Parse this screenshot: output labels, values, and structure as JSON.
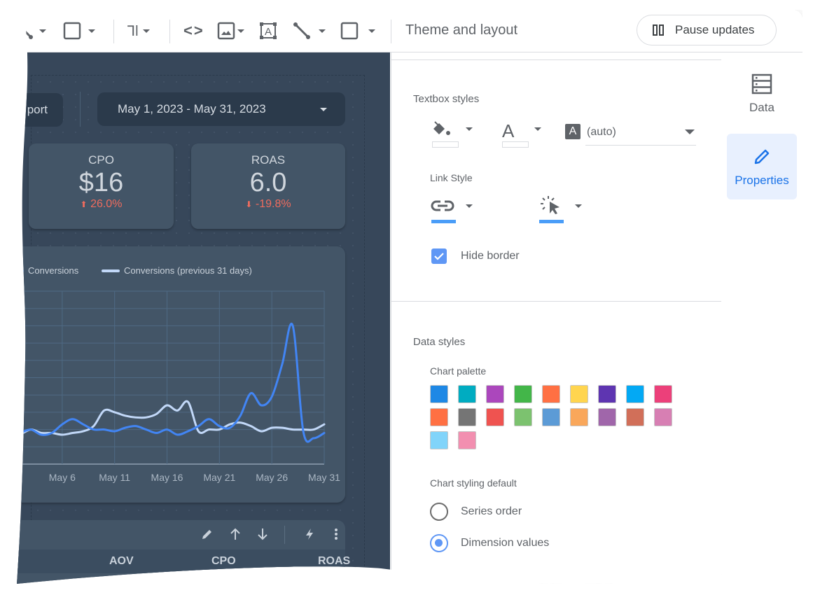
{
  "toolbar": {
    "tools": [
      {
        "name": "line-tool",
        "has_dropdown": true
      },
      {
        "name": "rectangle-tool",
        "has_dropdown": true
      },
      {
        "name": "text-format-tool",
        "glyph": "Ꞁl",
        "has_dropdown": true
      },
      {
        "name": "embed-code-tool",
        "glyph": "<>"
      },
      {
        "name": "image-tool",
        "has_dropdown": true
      },
      {
        "name": "text-box-tool"
      },
      {
        "name": "line-tool-2",
        "has_dropdown": true
      },
      {
        "name": "shape-tool",
        "has_dropdown": true
      }
    ],
    "theme_label": "Theme and layout",
    "pause_label": "Pause updates"
  },
  "canvas": {
    "report_button_label": "port",
    "date_range": "May 1, 2023 - May 31, 2023",
    "kpis": [
      {
        "label": "CPO",
        "value": "$16",
        "change": "26.0%",
        "direction": "up"
      },
      {
        "label": "ROAS",
        "value": "6.0",
        "change": "-19.8%",
        "direction": "down"
      }
    ],
    "table": {
      "columns": [
        "AOV",
        "CPO",
        "ROAS"
      ]
    }
  },
  "chart_data": {
    "type": "line",
    "title": "",
    "xlabel": "",
    "ylabel": "",
    "x_tick_labels": [
      "May 6",
      "May 11",
      "May 16",
      "May 21",
      "May 26",
      "May 31"
    ],
    "x": [
      2,
      3,
      4,
      5,
      6,
      7,
      8,
      9,
      10,
      11,
      12,
      13,
      14,
      15,
      16,
      17,
      18,
      19,
      20,
      21,
      22,
      23,
      24,
      25,
      26,
      27,
      28,
      29,
      30,
      31
    ],
    "grid": true,
    "legend_position": "top-left",
    "y_gridlines": 10,
    "ylim": [
      0,
      10
    ],
    "series": [
      {
        "name": "Conversions",
        "color": "#4285f4",
        "values": [
          1.8,
          2.0,
          1.7,
          1.8,
          2.3,
          2.6,
          2.3,
          2.0,
          2.0,
          1.9,
          2.1,
          2.2,
          2.0,
          1.8,
          2.0,
          1.7,
          1.9,
          2.2,
          2.6,
          2.2,
          2.1,
          2.8,
          4.1,
          3.4,
          3.9,
          5.8,
          8.0,
          1.9,
          1.5,
          1.8
        ]
      },
      {
        "name": "Conversions (previous 31 days)",
        "color": "#c2d8f8",
        "values": [
          1.7,
          2.0,
          1.8,
          1.8,
          1.7,
          1.8,
          1.9,
          2.2,
          3.1,
          3.0,
          2.8,
          2.7,
          2.7,
          2.9,
          3.4,
          3.1,
          3.6,
          1.9,
          2.0,
          2.0,
          2.3,
          2.4,
          2.2,
          1.9,
          2.1,
          2.1,
          2.0,
          2.0,
          2.0,
          2.3
        ]
      }
    ]
  },
  "panel": {
    "textbox_styles_title": "Textbox styles",
    "font_family_value": "(auto)",
    "link_style_title": "Link Style",
    "hide_border_label": "Hide border",
    "hide_border_checked": true,
    "data_styles_title": "Data styles",
    "chart_palette_title": "Chart palette",
    "palette": [
      "#1e88e5",
      "#00acc1",
      "#ab47bc",
      "#43b649",
      "#ff7043",
      "#ffd54f",
      "#5e35b1",
      "#03a9f4",
      "#ec407a",
      "#ff7043",
      "#757575",
      "#ef5350",
      "#7cc26f",
      "#5c9bd6",
      "#f9a75b",
      "#a066aa",
      "#d16f59",
      "#d77fb3",
      "#81d4fa",
      "#f28fb0"
    ],
    "chart_styling_title": "Chart styling default",
    "styling_options": [
      {
        "label": "Series order",
        "selected": false
      },
      {
        "label": "Dimension values",
        "selected": true
      }
    ],
    "accent_color": "#4285f4",
    "link_underline_color": "#4a9df8"
  },
  "rail": {
    "items": [
      {
        "label": "Data",
        "icon": "database-icon",
        "active": false
      },
      {
        "label": "Properties",
        "icon": "pencil-icon",
        "active": true
      }
    ]
  }
}
